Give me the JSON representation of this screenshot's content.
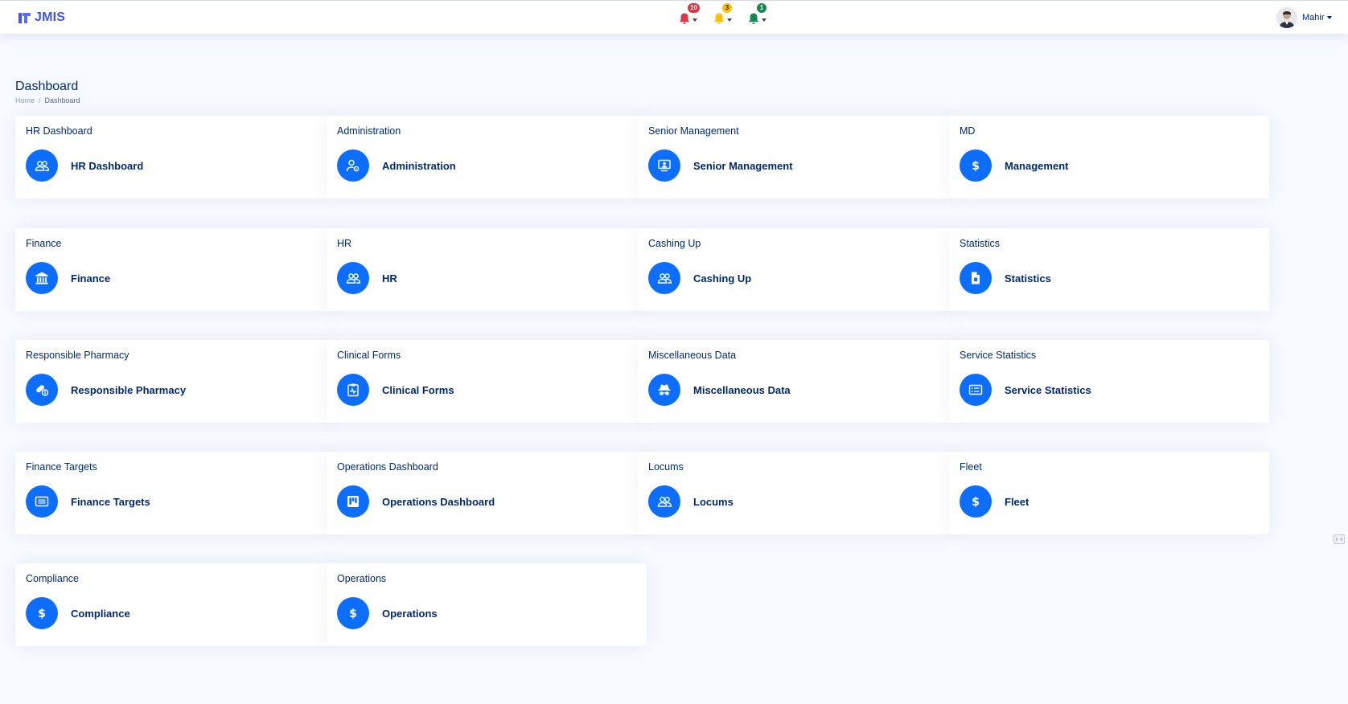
{
  "app": {
    "name": "JMIS"
  },
  "notifications": [
    {
      "id": "red",
      "count": "10",
      "color": "#dc3545",
      "badge_text_color": "#ffffff",
      "icon": "bell-icon"
    },
    {
      "id": "yellow",
      "count": "3",
      "color": "#ffc107",
      "badge_text_color": "#212529",
      "icon": "bell-icon"
    },
    {
      "id": "green",
      "count": "1",
      "color": "#198754",
      "badge_text_color": "#ffffff",
      "icon": "bell-icon"
    }
  ],
  "user": {
    "name": "Mahir"
  },
  "page": {
    "title": "Dashboard"
  },
  "breadcrumb": {
    "home": "Home",
    "separator": "/",
    "current": "Dashboard"
  },
  "accent_color": "#0d6efd",
  "cards": [
    {
      "title": "HR Dashboard",
      "label": "HR Dashboard",
      "icon": "people-icon"
    },
    {
      "title": "Administration",
      "label": "Administration",
      "icon": "user-gear-icon"
    },
    {
      "title": "Senior Management",
      "label": "Senior Management",
      "icon": "presentation-icon"
    },
    {
      "title": "MD",
      "label": "Management",
      "icon": "dollar-icon"
    },
    {
      "title": "Finance",
      "label": "Finance",
      "icon": "bank-icon"
    },
    {
      "title": "HR",
      "label": "HR",
      "icon": "people-icon"
    },
    {
      "title": "Cashing Up",
      "label": "Cashing Up",
      "icon": "people-icon"
    },
    {
      "title": "Statistics",
      "label": "Statistics",
      "icon": "file-icon"
    },
    {
      "title": "Responsible Pharmacy",
      "label": "Responsible Pharmacy",
      "icon": "capsule-icon"
    },
    {
      "title": "Clinical Forms",
      "label": "Clinical Forms",
      "icon": "clipboard-pulse-icon"
    },
    {
      "title": "Miscellaneous Data",
      "label": "Miscellaneous Data",
      "icon": "incognito-icon"
    },
    {
      "title": "Service Statistics",
      "label": "Service Statistics",
      "icon": "card-list-icon"
    },
    {
      "title": "Finance Targets",
      "label": "Finance Targets",
      "icon": "list-icon"
    },
    {
      "title": "Operations Dashboard",
      "label": "Operations Dashboard",
      "icon": "kanban-icon"
    },
    {
      "title": "Locums",
      "label": "Locums",
      "icon": "people-icon"
    },
    {
      "title": "Fleet",
      "label": "Fleet",
      "icon": "dollar-icon"
    },
    {
      "title": "Compliance",
      "label": "Compliance",
      "icon": "dollar-icon"
    },
    {
      "title": "Operations",
      "label": "Operations",
      "icon": "dollar-icon"
    }
  ]
}
